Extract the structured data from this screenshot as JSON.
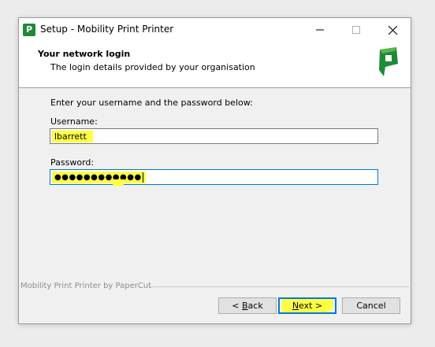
{
  "window": {
    "title": "Setup - Mobility Print Printer",
    "icon": "papercut-p-icon",
    "icon_letter": "P"
  },
  "header": {
    "title": "Your network login",
    "subtitle": "The login details provided by your organisation",
    "logo": "papercut-logo-icon"
  },
  "form": {
    "instruction": "Enter your username and the password below:",
    "username_label": "Username:",
    "username_value": "lbarrett",
    "password_label": "Password:",
    "password_value": "●●●●●●●●●●●●"
  },
  "footer": {
    "brand": "Mobility Print Printer by PaperCut"
  },
  "buttons": {
    "back_mnemonic": "B",
    "back_prefix": "< ",
    "back_rest": "ack",
    "next_mnemonic": "N",
    "next_rest": "ext >",
    "cancel": "Cancel"
  },
  "colors": {
    "brand_green": "#1e8a38",
    "highlight": "#ffff44",
    "focus_blue": "#0078d7"
  }
}
